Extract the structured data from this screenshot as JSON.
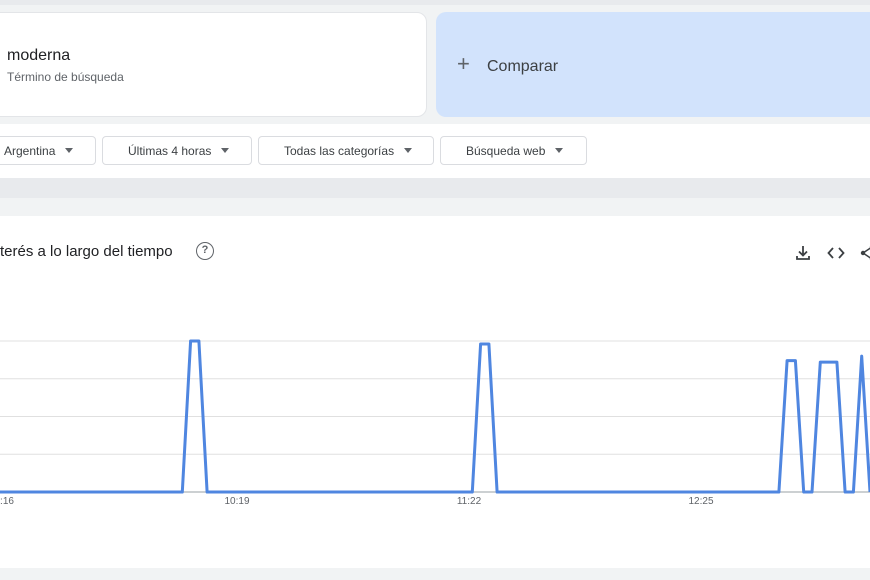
{
  "search": {
    "term": "moderna",
    "term_subtitle": "Término de búsqueda",
    "compare_label": "Comparar"
  },
  "filters": {
    "region": "Argentina",
    "time_range": "Últimas 4 horas",
    "category": "Todas las categorías",
    "search_type": "Búsqueda web"
  },
  "chart_section": {
    "title": "terés a lo largo del tiempo",
    "icons": [
      "help-icon",
      "download-icon",
      "embed-icon",
      "share-icon"
    ]
  },
  "chart_data": {
    "type": "line",
    "x_tick_labels": [
      ":16",
      "10:19",
      "11:22",
      "12:25"
    ],
    "x": [
      0,
      22,
      23,
      24,
      25,
      57,
      58,
      59,
      60,
      94,
      95,
      96,
      97,
      98,
      99,
      101,
      102,
      103,
      104,
      105
    ],
    "values": [
      0,
      0,
      100,
      100,
      0,
      0,
      98,
      98,
      0,
      0,
      87,
      87,
      0,
      0,
      86,
      86,
      0,
      0,
      90,
      0
    ],
    "xlim": [
      0,
      105
    ],
    "ylim": [
      0,
      100
    ],
    "grid": true,
    "series_color": "#4f86e0",
    "grid_color": "#e0e0e0"
  }
}
